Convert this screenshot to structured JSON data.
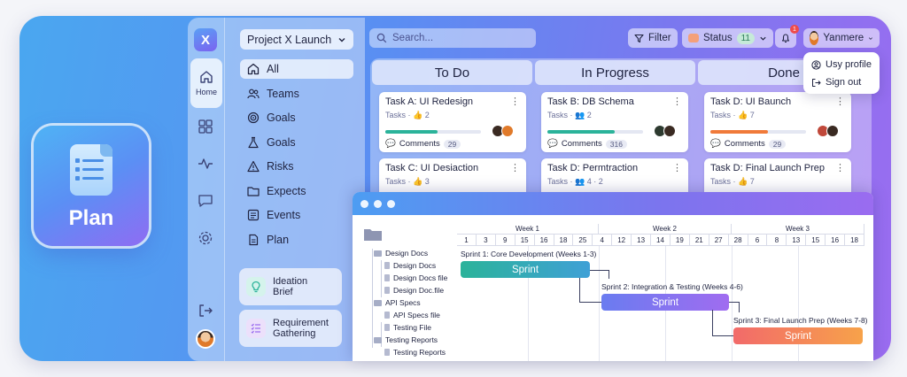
{
  "plan_tile": {
    "label": "Plan"
  },
  "rail": {
    "home_label": "Home"
  },
  "project_select": {
    "value": "Project X Launch"
  },
  "nav": {
    "items": [
      {
        "label": "All",
        "icon": "home-icon"
      },
      {
        "label": "Teams",
        "icon": "users-icon"
      },
      {
        "label": "Goals",
        "icon": "target-icon"
      },
      {
        "label": "Goals",
        "icon": "flask-icon"
      },
      {
        "label": "Risks",
        "icon": "warning-icon"
      },
      {
        "label": "Expects",
        "icon": "folder-icon"
      },
      {
        "label": "Events",
        "icon": "list-icon"
      },
      {
        "label": "Plan",
        "icon": "document-icon"
      }
    ],
    "cards": [
      {
        "label": "Ideation Brief",
        "line1": "Ideation",
        "line2": "Brief",
        "icon": "lightbulb-icon",
        "color": "#5ec9b6"
      },
      {
        "label": "Requirement Gathering",
        "line1": "Requirement",
        "line2": "Gathering",
        "icon": "checklist-icon",
        "color": "#b58cf2"
      }
    ]
  },
  "search": {
    "placeholder": "Search..."
  },
  "toolbar": {
    "filter_label": "Filter",
    "status_label": "Status",
    "status_count": "11",
    "notification_count": "1",
    "user_name": "Yanmere"
  },
  "user_menu": {
    "items": [
      "Usy profile",
      "Sign out"
    ]
  },
  "kanban": {
    "columns": [
      {
        "title": "To Do"
      },
      {
        "title": "In Progress"
      },
      {
        "title": "Done"
      }
    ],
    "cards": [
      {
        "title": "Task A: UI Redesign",
        "meta": "Tasks · 👍 2",
        "progress": 0.55,
        "color": "#2bb39a",
        "comments_label": "Comments",
        "comments": "29"
      },
      {
        "title": "Task B: DB Schema",
        "meta": "Tasks · 👥 2",
        "progress": 0.7,
        "color": "#2bb39a",
        "comments_label": "Comments",
        "comments": "316"
      },
      {
        "title": "Task D: UI Baunch",
        "meta": "Tasks · 👍 7",
        "progress": 0.6,
        "color": "#f07a3a",
        "comments_label": "Comments",
        "comments": "29"
      },
      {
        "title": "Task C: UI Desiaction",
        "meta": "Tasks · 👍 3"
      },
      {
        "title": "Task D: Permtraction",
        "meta": "Tasks · 👥 4 · 2"
      },
      {
        "title": "Task D: Final Launch Prep",
        "meta": "Tasks · 👍 7"
      }
    ]
  },
  "gantt": {
    "weeks": [
      "Week 1",
      "Week 2",
      "Week 3"
    ],
    "days": [
      "1",
      "3",
      "9",
      "15",
      "16",
      "18",
      "25",
      "4",
      "12",
      "13",
      "14",
      "19",
      "21",
      "27",
      "28",
      "6",
      "8",
      "13",
      "15",
      "16",
      "18"
    ],
    "tree": [
      {
        "label": "Design Docs",
        "type": "folder"
      },
      {
        "label": "Design Docs",
        "type": "file"
      },
      {
        "label": "Design Docs file",
        "type": "file"
      },
      {
        "label": "Design Doc.file",
        "type": "file"
      },
      {
        "label": "API Specs",
        "type": "folder"
      },
      {
        "label": "API Specs file",
        "type": "file"
      },
      {
        "label": "Testing File",
        "type": "file"
      },
      {
        "label": "Testing Reports",
        "type": "folder"
      },
      {
        "label": "Testing Reports",
        "type": "file"
      }
    ],
    "sprints": [
      {
        "caption": "Sprint 1: Core Development (Weeks 1-3)",
        "label": "Sprint"
      },
      {
        "caption": "Sprint 2: Integration & Testing (Weeks 4-6)",
        "label": "Sprint"
      },
      {
        "caption": "Sprint 3: Final Launch Prep (Weeks 7-8)",
        "label": "Sprint"
      }
    ]
  }
}
